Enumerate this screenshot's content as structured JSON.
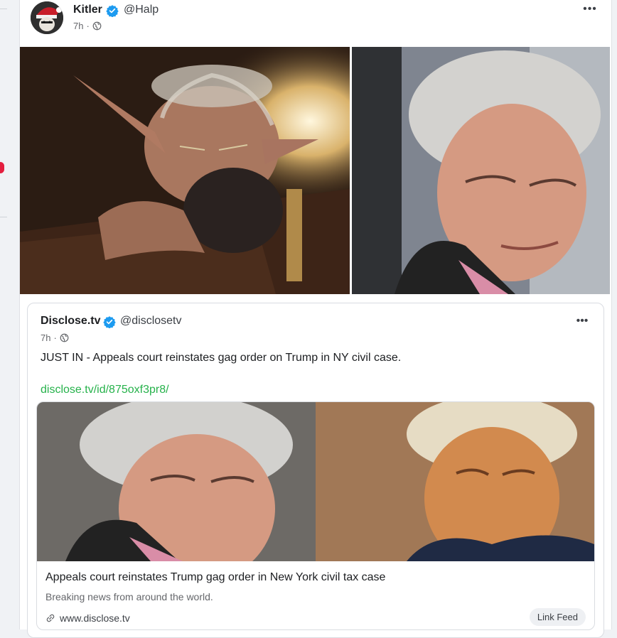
{
  "post": {
    "author_name": "Kitler",
    "handle": "@Halp",
    "time": "7h",
    "separator": "·",
    "more_label": "•••",
    "icons": [
      "verified-icon",
      "globe-icon",
      "more-icon"
    ]
  },
  "quoted": {
    "author_name": "Disclose.tv",
    "handle": "@disclosetv",
    "time": "7h",
    "separator": "·",
    "more_label": "•••",
    "text": "JUST IN - Appeals court reinstates gag order on Trump in NY civil case.",
    "link_text": "disclose.tv/id/875oxf3pr8/",
    "link_card": {
      "title": "Appeals court reinstates Trump gag order in New York civil tax case",
      "description": "Breaking news from around the world.",
      "domain": "www.disclose.tv",
      "badge": "Link Feed"
    }
  },
  "colors": {
    "verified": "#1d9bf0",
    "link": "#26b24b",
    "muted": "#65676b"
  }
}
